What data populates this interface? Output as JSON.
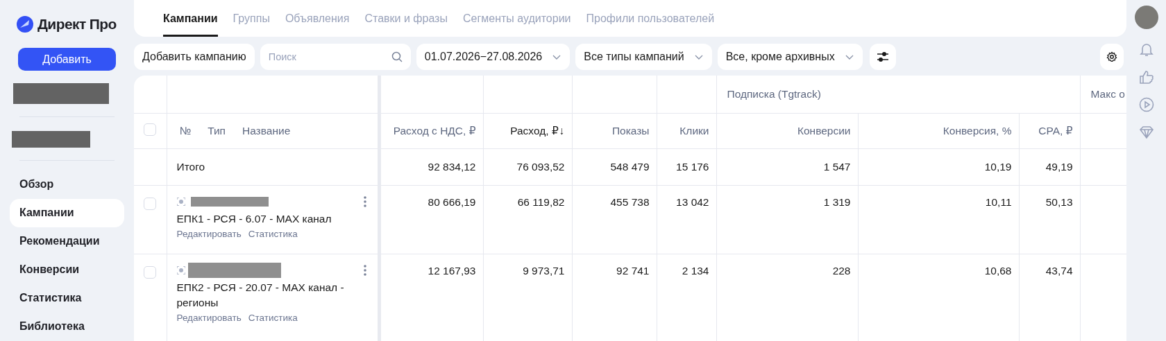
{
  "sidebar": {
    "logo": "Директ Про",
    "add_button": "Добавить",
    "items": [
      {
        "label": "Обзор",
        "selected": false
      },
      {
        "label": "Кампании",
        "selected": true
      },
      {
        "label": "Рекомендации",
        "selected": false
      },
      {
        "label": "Конверсии",
        "selected": false
      },
      {
        "label": "Статистика",
        "selected": false
      },
      {
        "label": "Библиотека",
        "selected": false
      }
    ]
  },
  "tabs": [
    {
      "label": "Кампании",
      "selected": true
    },
    {
      "label": "Группы",
      "selected": false
    },
    {
      "label": "Объявления",
      "selected": false
    },
    {
      "label": "Ставки и фразы",
      "selected": false
    },
    {
      "label": "Сегменты аудитории",
      "selected": false
    },
    {
      "label": "Профили пользователей",
      "selected": false
    }
  ],
  "toolbar": {
    "add_campaign": "Добавить кампанию",
    "search": {
      "placeholder": "Поиск"
    },
    "date_range": "01.07.2026−27.08.2026",
    "campaign_types": "Все типы кампаний",
    "status_filter": "Все, кроме архивных"
  },
  "table": {
    "select_all": {
      "checked": false
    },
    "name_headers": [
      "№",
      "Тип",
      "Название"
    ],
    "columns": [
      {
        "kind": "single",
        "label": "Расход с НДС, ₽",
        "sorted": false
      },
      {
        "kind": "single",
        "label": "Расход, ₽",
        "sorted": true,
        "sort_indicator": "↓"
      },
      {
        "kind": "single",
        "label": "Показы",
        "sorted": false
      },
      {
        "kind": "single",
        "label": "Клики",
        "sorted": false
      },
      {
        "kind": "group",
        "label": "Подписка (Tgtrack)",
        "columns": [
          {
            "label": "Конверсии",
            "sorted": false
          },
          {
            "label": "Конверсия, %",
            "sorted": false
          },
          {
            "label": "CPA, ₽",
            "sorted": false
          }
        ]
      },
      {
        "kind": "group",
        "label": "Макс о"
      }
    ],
    "total": {
      "label": "Итого",
      "values": [
        "92 834,12",
        "76 093,52",
        "548 479",
        "15 176",
        "1 547",
        "10,19",
        "49,19"
      ]
    },
    "rows": [
      {
        "checked": false,
        "name": "ЕПК1 - РСЯ - 6.07 - MAX канал",
        "links": [
          "Редактировать",
          "Статистика"
        ],
        "values": [
          "80 666,19",
          "66 119,82",
          "455 738",
          "13 042",
          "1 319",
          "10,11",
          "50,13"
        ]
      },
      {
        "checked": false,
        "name": "ЕПК2 - РСЯ - 20.07 - MAX канал - регионы",
        "links": [
          "Редактировать",
          "Статистика"
        ],
        "values": [
          "12 167,93",
          "9 973,71",
          "92 741",
          "2 134",
          "228",
          "10,68",
          "43,74"
        ]
      }
    ]
  }
}
